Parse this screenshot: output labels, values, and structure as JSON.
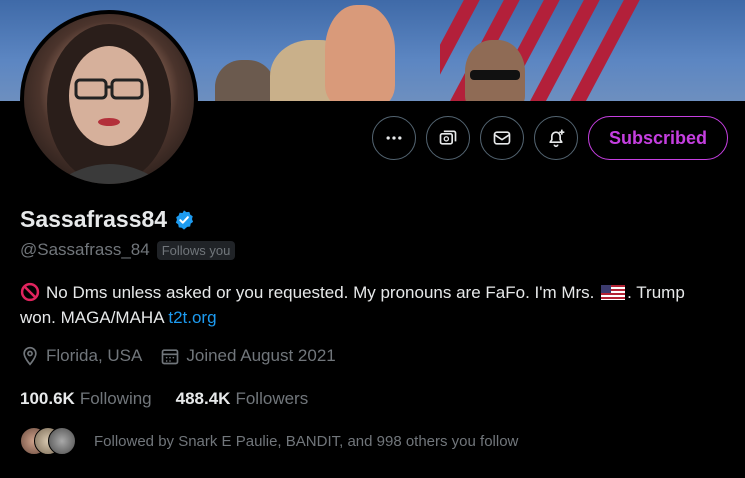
{
  "profile": {
    "display_name": "Sassafrass84",
    "verified": true,
    "handle": "@Sassafrass_84",
    "follows_you": "Follows you",
    "bio_text": "No Dms unless asked or you requested. My pronouns are FaFo. I'm Mrs.",
    "bio_after_flag": ". Trump won. MAGA/MAHA",
    "bio_link": "t2t.org",
    "location": "Florida, USA",
    "joined": "Joined August 2021"
  },
  "actions": {
    "more_icon": "more-icon",
    "subscriptions_icon": "subscription-icon",
    "message_icon": "mail-icon",
    "notify_icon": "bell-plus-icon",
    "subscribed_label": "Subscribed"
  },
  "stats": {
    "following_count": "100.6K",
    "following_label": "Following",
    "followers_count": "488.4K",
    "followers_label": "Followers"
  },
  "followed_by": "Followed by Snark E Paulie, BANDIT, and 998 others you follow",
  "colors": {
    "accent_purple": "#c53fe0",
    "link_blue": "#1d9bf0",
    "verified_blue": "#1d9bf0",
    "muted_gray": "#71767b"
  }
}
